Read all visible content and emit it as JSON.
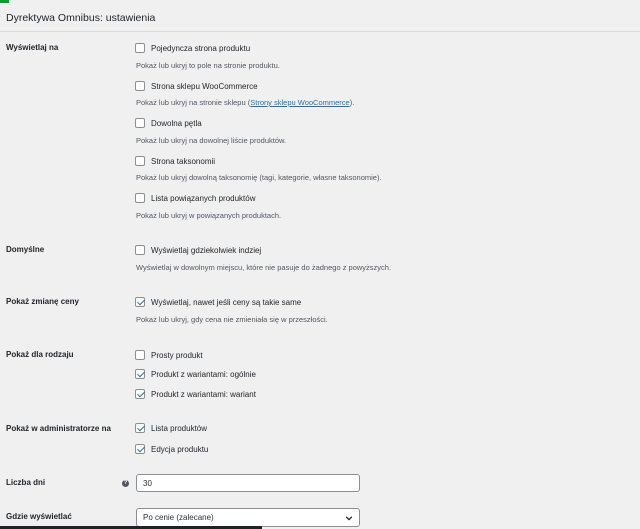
{
  "header": {
    "title": "Dyrektywa Omnibus: ustawienia"
  },
  "sections": {
    "display_on": {
      "label": "Wyświetlaj na",
      "options": [
        {
          "label": "Pojedyncza strona produktu",
          "checked": false,
          "description": "Pokaż lub ukryj to pole na stronie produktu."
        },
        {
          "label": "Strona sklepu WooCommerce",
          "checked": false,
          "description_prefix": "Pokaż lub ukryj na stronie sklepu (",
          "description_link": "Strony sklepu WooCommerce",
          "description_suffix": ")."
        },
        {
          "label": "Dowolna pętla",
          "checked": false,
          "description": "Pokaż lub ukryj na dowolnej liście produktów."
        },
        {
          "label": "Strona taksonomii",
          "checked": false,
          "description": "Pokaż lub ukryj dowolną taksonomię (tagi, kategorie, własne taksonomie)."
        },
        {
          "label": "Lista powiązanych produktów",
          "checked": false,
          "description": "Pokaż lub ukryj w powiązanych produktach."
        }
      ]
    },
    "default": {
      "label": "Domyślne",
      "option": {
        "label": "Wyświetlaj gdziekolwiek indziej",
        "checked": false,
        "description": "Wyświetlaj w dowolnym miejscu, które nie pasuje do żadnego z powyższych."
      }
    },
    "price_change": {
      "label": "Pokaż zmianę ceny",
      "option": {
        "label": "Wyświetlaj, nawet jeśli ceny są takie same",
        "checked": true,
        "description": "Pokaż lub ukryj, gdy cena nie zmieniała się w przeszłości."
      }
    },
    "product_type": {
      "label": "Pokaż dla rodzaju",
      "options": [
        {
          "label": "Prosty produkt",
          "checked": false
        },
        {
          "label": "Produkt z wariantami: ogólnie",
          "checked": true
        },
        {
          "label": "Produkt z wariantami: wariant",
          "checked": true
        }
      ]
    },
    "admin": {
      "label": "Pokaż w administratorze na",
      "options": [
        {
          "label": "Lista produktów",
          "checked": true
        },
        {
          "label": "Edycja produktu",
          "checked": true
        }
      ]
    },
    "days": {
      "label": "Liczba dni",
      "help_icon": "question-mark-icon",
      "value": "30"
    },
    "where": {
      "label": "Gdzie wyświetlać",
      "selected": "Po cenie (zalecane)"
    }
  },
  "colors": {
    "accent": "#2271b1",
    "background": "#f0f0f1",
    "text": "#1d2327",
    "muted": "#50575e",
    "success": "#00a32a"
  }
}
